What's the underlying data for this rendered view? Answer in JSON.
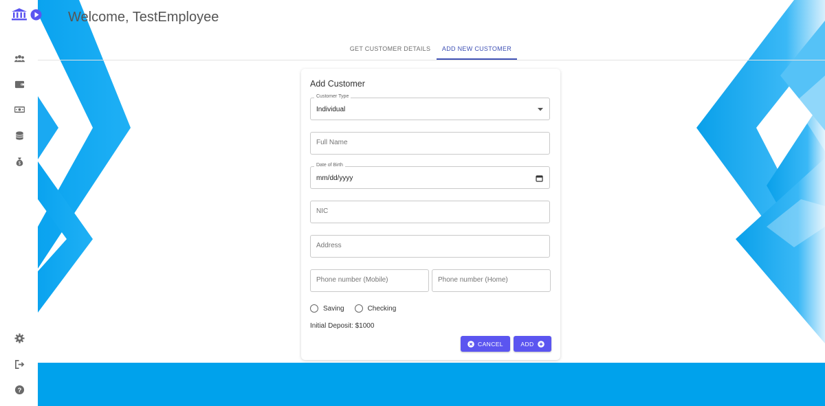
{
  "header": {
    "welcome": "Welcome, TestEmployee"
  },
  "tabs": [
    {
      "label": "GET CUSTOMER DETAILS"
    },
    {
      "label": "ADD NEW CUSTOMER",
      "active": true
    }
  ],
  "sidebar": {
    "top_items": [
      "users-icon",
      "wallet-icon",
      "money-icon",
      "coins-icon",
      "money-bag-icon"
    ],
    "bottom_items": [
      "gear-icon",
      "logout-icon",
      "help-icon"
    ]
  },
  "form": {
    "title": "Add Customer",
    "customer_type": {
      "label": "Customer Type",
      "value": "Individual"
    },
    "full_name": {
      "placeholder": "Full Name"
    },
    "dob": {
      "label": "Date of Birth",
      "value": "mm/dd/yyyy"
    },
    "nic": {
      "placeholder": "NIC"
    },
    "address": {
      "placeholder": "Address"
    },
    "phone_mobile": {
      "placeholder": "Phone number (Mobile)"
    },
    "phone_home": {
      "placeholder": "Phone number (Home)"
    },
    "account_types": [
      "Saving",
      "Checking"
    ],
    "initial_deposit": "Initial Deposit: $1000",
    "cancel_label": "CANCEL",
    "add_label": "ADD"
  },
  "colors": {
    "accent": "#3f51b5",
    "button": "#5b55f0",
    "background_blue": "#00a2ec",
    "sidebar_icon": "#6a6a6a"
  }
}
